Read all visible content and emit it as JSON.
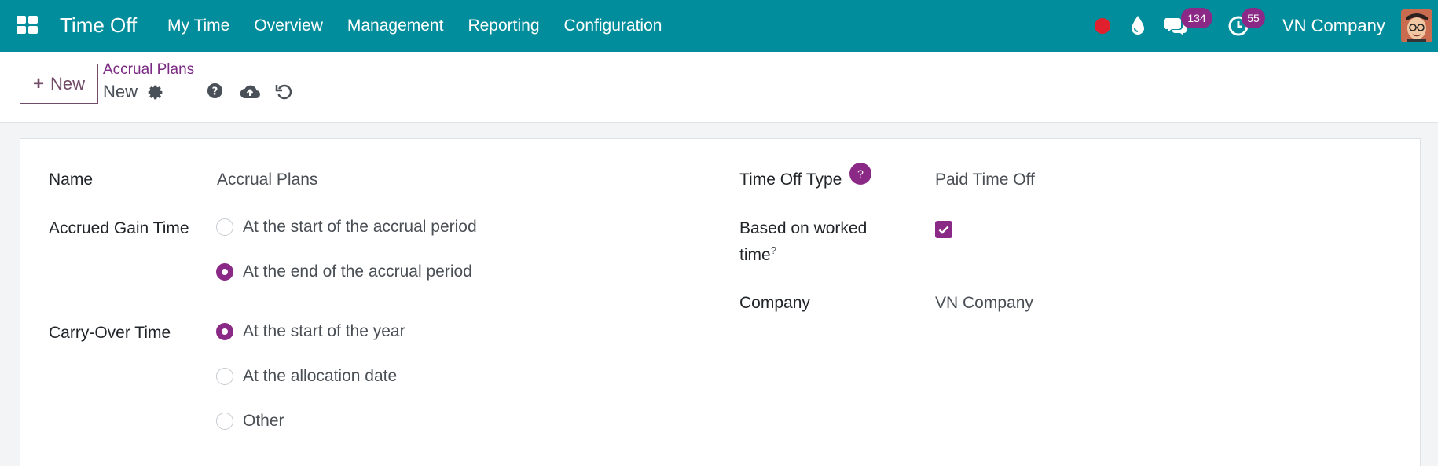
{
  "navbar": {
    "app_title": "Time Off",
    "menu": [
      "My Time",
      "Overview",
      "Management",
      "Reporting",
      "Configuration"
    ],
    "chat_count": "134",
    "activity_count": "55",
    "company": "VN Company"
  },
  "control_panel": {
    "new_label": "New",
    "breadcrumb_parent": "Accrual Plans",
    "breadcrumb_current": "New"
  },
  "form": {
    "name_label": "Name",
    "name_value": "Accrual Plans",
    "accrued_gain_label": "Accrued Gain Time",
    "accrued_gain_options": [
      "At the start of the accrual period",
      "At the end of the accrual period"
    ],
    "accrued_gain_selected": 1,
    "carry_over_label": "Carry-Over Time",
    "carry_over_options": [
      "At the start of the year",
      "At the allocation date",
      "Other"
    ],
    "carry_over_selected": 0,
    "time_off_type_label": "Time Off Type",
    "time_off_type_help": "?",
    "time_off_type_value": "Paid Time Off",
    "based_on_worked_line1": "Based on worked",
    "based_on_worked_line2": "time",
    "based_on_worked_help": "?",
    "based_on_worked_checked": true,
    "company_label": "Company",
    "company_value": "VN Company"
  },
  "colors": {
    "navbar": "#018d9b",
    "accent": "#8a2a86",
    "record_dot": "#e0202c"
  }
}
